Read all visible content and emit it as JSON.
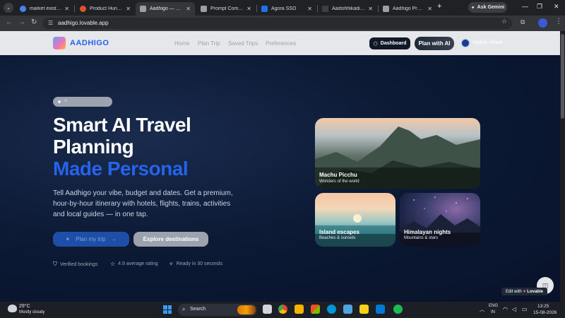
{
  "browser": {
    "tabs": [
      {
        "title": "market existing w",
        "favicon_color": "#4285f4",
        "active": false
      },
      {
        "title": "Product Hunt – Th",
        "favicon_color": "#da552f",
        "active": false
      },
      {
        "title": "Aadhigo — Smart",
        "favicon_color": "#9aa0a6",
        "active": true
      },
      {
        "title": "Prompt Compress",
        "favicon_color": "#9aa0a6",
        "active": false
      },
      {
        "title": "Agora SSO",
        "favicon_color": "#1a73e8",
        "active": false
      },
      {
        "title": "Aadishhikadi | Ba",
        "favicon_color": "#3c4043",
        "active": false
      },
      {
        "title": "Aadhigo Product",
        "favicon_color": "#9aa0a6",
        "active": false
      }
    ],
    "close_glyph": "✕",
    "new_tab": "+",
    "ask_gemini": "Ask Gemini",
    "url": "aadhigo.lovable.app",
    "window_controls": {
      "minimize": "—",
      "maximize": "❐",
      "close": "✕"
    }
  },
  "site": {
    "brand": "AADHIGO",
    "nav": [
      "Home",
      "Plan Trip",
      "Saved Trips",
      "Preferences"
    ],
    "dashboard": "Dashboard",
    "plan_ai": "Plan with AI",
    "user_name": "Aadish Hikadi"
  },
  "hero": {
    "title_line1": "Smart AI Travel",
    "title_line2": "Planning",
    "title_accent": "Made Personal",
    "description": "Tell Aadhigo your vibe, budget and dates. Get a premium, hour-by-hour itinerary with hotels, flights, trains, activities and local guides — in one tap.",
    "primary_cta": "Plan my trip",
    "primary_arrow": "→",
    "secondary_cta": "Explore destinations",
    "features": [
      "Verified bookings",
      "4.9 average rating",
      "Ready in 30 seconds"
    ]
  },
  "cards": [
    {
      "title": "Machu Picchu",
      "subtitle": "Wonders of the world"
    },
    {
      "title": "Island escapes",
      "subtitle": "Beaches & sunsets"
    },
    {
      "title": "Himalayan nights",
      "subtitle": "Mountains & stars"
    }
  ],
  "lovable": {
    "edit_with": "Edit with",
    "brand": "Lovable"
  },
  "taskbar": {
    "weather_temp": "29°C",
    "weather_desc": "Mostly cloudy",
    "search": "Search",
    "lang_top": "ENG",
    "lang_bottom": "IN",
    "time": "13:25",
    "date": "15-08-2026"
  }
}
